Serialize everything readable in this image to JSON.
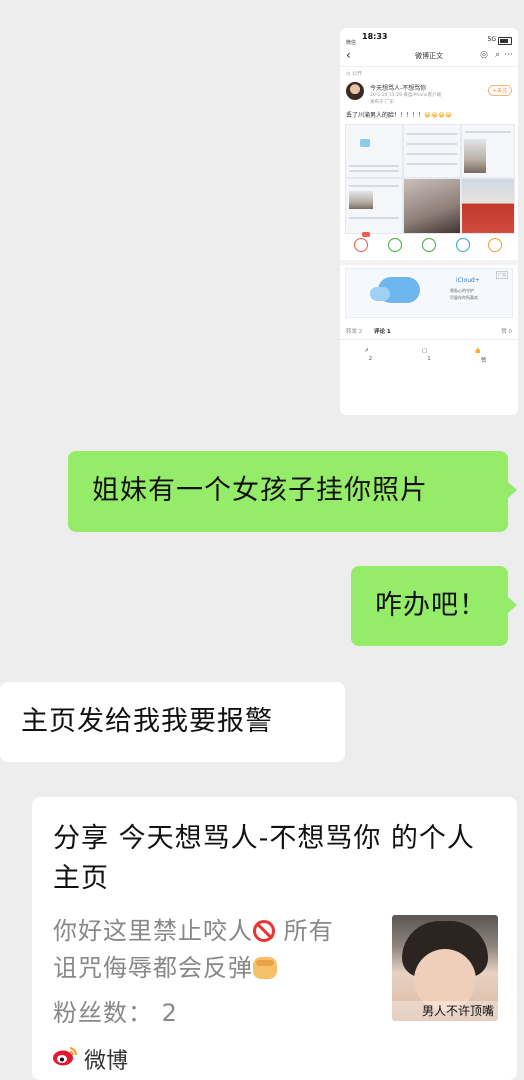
{
  "shared_screenshot": {
    "status_bar": {
      "time": "18:33",
      "carrier": "微信",
      "network": "5G"
    },
    "nav_title": "微博正文",
    "visibility": "公开",
    "author": {
      "name": "今天想骂人-不想骂你",
      "meta": "20-5-24 15:29 来自iPhone客户端",
      "location": "发布于 广东",
      "follow_label": "+关注"
    },
    "post_text": "丢了川渝男人的脸！！！！！",
    "post_emoji": "😭😭😭😭",
    "action_tag": "…",
    "ad": {
      "brand": "iCloud+",
      "line1": "隐私心的守护",
      "line2": "尽量存你所喜欢",
      "ad_tag": "广告"
    },
    "tabs": {
      "repost": "转发 2",
      "comments": "评论 1",
      "likes": "赞 0"
    },
    "bottom": {
      "repost": "2",
      "comment": "1",
      "like": "赞"
    }
  },
  "messages": [
    {
      "side": "right",
      "text": "姐妹有一个女孩子挂你照片"
    },
    {
      "side": "right",
      "text": "咋办吧！"
    },
    {
      "side": "left",
      "text": "主页发给我我要报警"
    }
  ],
  "share_card": {
    "title": "分享 今天想骂人-不想骂你 的个人主页",
    "desc_line1": "你好这里禁止咬人",
    "desc_line1b": " 所有",
    "desc_line2": "诅咒侮辱都会反弹",
    "fans": "粉丝数：  2",
    "thumb_caption": "男人不许顶嘴",
    "source": "微博"
  },
  "colors": {
    "outgoing": "#95ec69",
    "incoming": "#ffffff",
    "background": "#ededed"
  }
}
